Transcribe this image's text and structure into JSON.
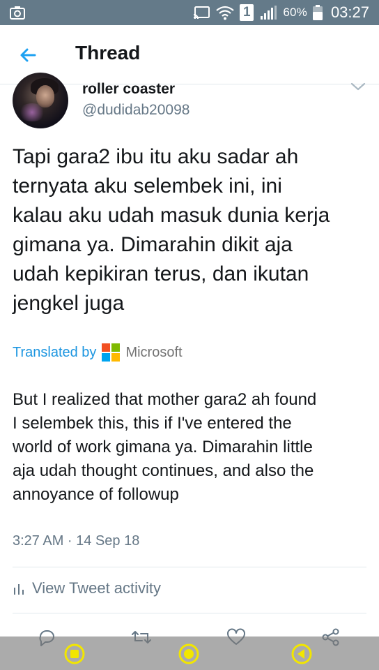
{
  "status_bar": {
    "battery_pct": "60%",
    "time": "03:27",
    "sim_slot": "1"
  },
  "header": {
    "title": "Thread"
  },
  "tweet": {
    "display_name": "roller coaster",
    "handle": "@dudidab20098",
    "text_lines": [
      "Tapi gara2 ibu itu aku sadar ah",
      "ternyata aku selembek ini, ini",
      "kalau aku udah masuk dunia kerja",
      "gimana ya. Dimarahin dikit aja",
      "udah kepikiran terus, dan ikutan",
      "jengkel juga"
    ],
    "translated_by": "Translated by",
    "translator_brand": "Microsoft",
    "translation_lines": [
      "But I realized that mother gara2 ah found",
      "I selembek this, this if I've entered the",
      "world of work gimana ya. Dimarahin little",
      "aja udah thought continues, and also the",
      "annoyance of followup"
    ],
    "timestamp": "3:27 AM · 14 Sep 18",
    "activity_label": "View Tweet activity"
  },
  "colors": {
    "status_bar_bg": "#647a89",
    "accent_blue": "#1b95e0",
    "secondary_text": "#657786",
    "nav_button_yellow": "#f2e600",
    "ms_red": "#f25022",
    "ms_green": "#7fba00",
    "ms_blue": "#00a4ef",
    "ms_yellow": "#ffb900"
  }
}
